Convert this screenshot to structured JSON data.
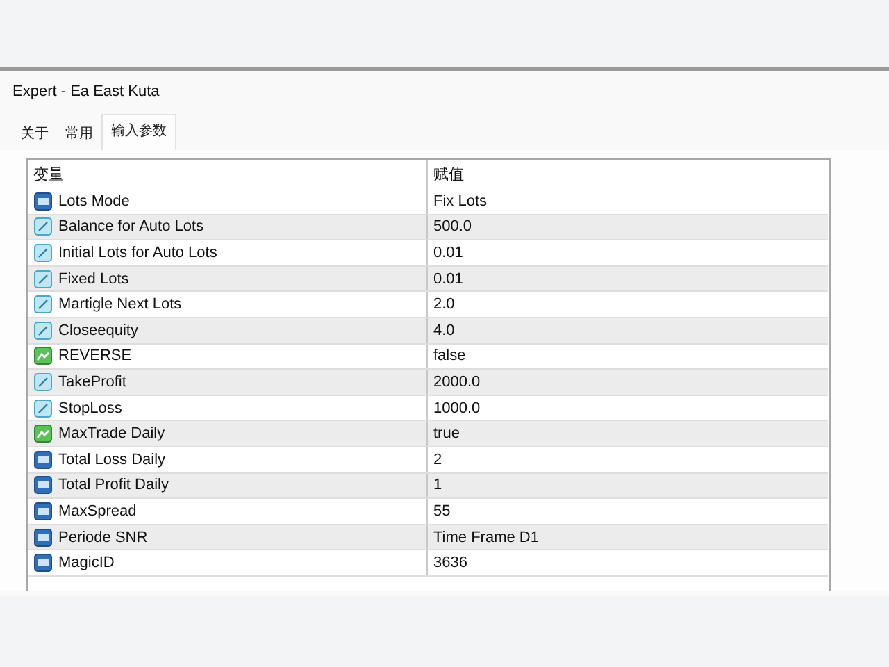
{
  "window": {
    "title": "Expert - Ea East Kuta"
  },
  "tabs": [
    {
      "label": "关于",
      "selected": false
    },
    {
      "label": "常用",
      "selected": false
    },
    {
      "label": "输入参数",
      "selected": true
    }
  ],
  "table": {
    "columns": [
      "变量",
      "赋值"
    ],
    "rows": [
      {
        "kind": "int",
        "name": "Lots Mode",
        "value": "Fix Lots"
      },
      {
        "kind": "double",
        "name": "Balance for Auto Lots",
        "value": "500.0"
      },
      {
        "kind": "double",
        "name": "Initial Lots for Auto Lots",
        "value": "0.01"
      },
      {
        "kind": "double",
        "name": "Fixed Lots",
        "value": "0.01"
      },
      {
        "kind": "double",
        "name": "Martigle Next Lots",
        "value": "2.0"
      },
      {
        "kind": "double",
        "name": "Closeequity",
        "value": "4.0"
      },
      {
        "kind": "bool",
        "name": "REVERSE",
        "value": "false"
      },
      {
        "kind": "double",
        "name": "TakeProfit",
        "value": "2000.0"
      },
      {
        "kind": "double",
        "name": "StopLoss",
        "value": "1000.0"
      },
      {
        "kind": "bool",
        "name": "MaxTrade Daily",
        "value": "true"
      },
      {
        "kind": "int",
        "name": "Total Loss Daily",
        "value": "2"
      },
      {
        "kind": "int",
        "name": "Total Profit Daily",
        "value": "1"
      },
      {
        "kind": "int",
        "name": "MaxSpread",
        "value": "55"
      },
      {
        "kind": "int",
        "name": "Periode SNR",
        "value": "Time Frame D1"
      },
      {
        "kind": "int",
        "name": "MagicID",
        "value": "3636"
      }
    ]
  }
}
